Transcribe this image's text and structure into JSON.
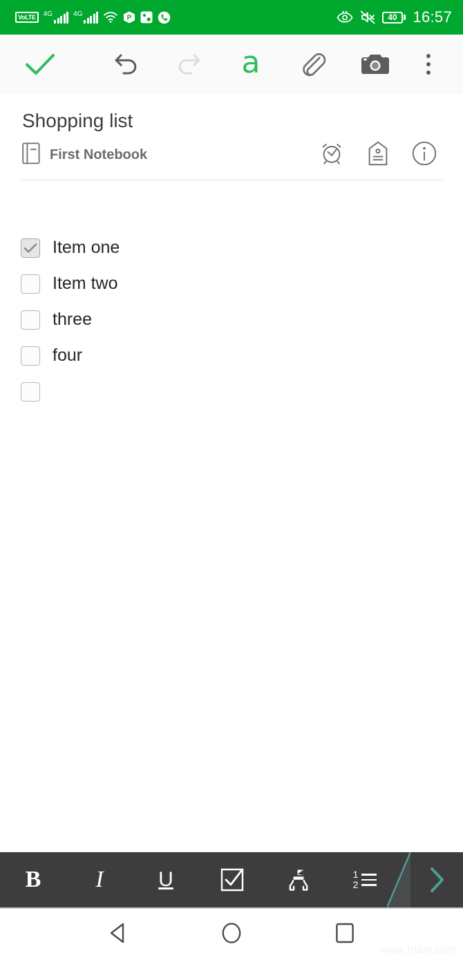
{
  "status_bar": {
    "background": "#00a82d",
    "volte_label": "VoLTE",
    "sim1_network": "4G",
    "sim2_network": "4G",
    "icons": [
      "volte-badge",
      "signal-bars-sim1",
      "signal-bars-sim2",
      "wifi-icon",
      "p-app-icon",
      "photo-app-icon",
      "phone-app-icon",
      "eye-comfort-icon",
      "mute-icon"
    ],
    "battery_level": "40",
    "time": "16:57"
  },
  "toolbar": {
    "done_label": "done-check",
    "undo_label": "undo",
    "redo_label": "redo",
    "format_text_label": "a",
    "attach_label": "attachment",
    "camera_label": "camera",
    "overflow_label": "more-options"
  },
  "note": {
    "title": "Shopping list",
    "notebook": "First Notebook",
    "actions": [
      "reminder",
      "tag",
      "info"
    ],
    "checklist": [
      {
        "text": "Item one",
        "checked": true
      },
      {
        "text": "Item two",
        "checked": false
      },
      {
        "text": "three",
        "checked": false
      },
      {
        "text": "four",
        "checked": false
      },
      {
        "text": "",
        "checked": false
      }
    ]
  },
  "format_bar": {
    "background": "#3d3d3d",
    "accent": "#4e9e95",
    "bold_label": "B",
    "italic_label": "I",
    "underline_label": "U",
    "checkbox_label": "checklist",
    "highlight_label": "highlighter",
    "numbered_list_label": "1 2",
    "numbered_list_num1": "1",
    "numbered_list_num2": "2",
    "next_label": "more-formats"
  },
  "nav_bar": {
    "back_label": "back",
    "home_label": "home",
    "recents_label": "recents"
  },
  "watermark": "www.frfam.com"
}
